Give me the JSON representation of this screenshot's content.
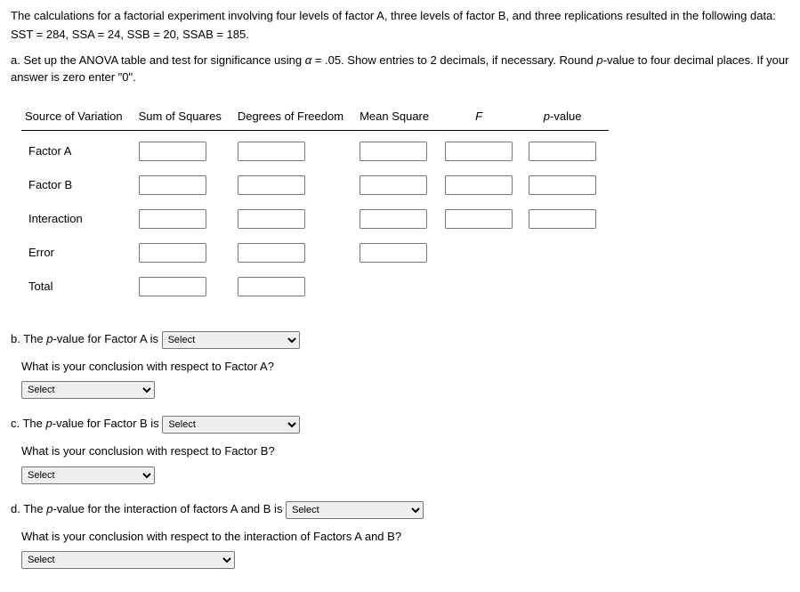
{
  "intro": "The calculations for a factorial experiment involving four levels of factor A, three levels of factor B, and three replications resulted in the following data: SST = 284, SSA = 24, SSB = 20, SSAB = 185.",
  "part_a": {
    "prefix": "a. Set up the ANOVA table and test for significance using ",
    "alpha": "α",
    "mid": " = .05. Show entries to 2 decimals, if necessary. Round ",
    "pval_word": "p",
    "suffix": "-value to four decimal places. If your answer is zero enter \"0\"."
  },
  "headers": {
    "source": "Source of Variation",
    "ss": "Sum of Squares",
    "df": "Degrees of Freedom",
    "ms": "Mean Square",
    "f": "F",
    "p": "p",
    "p_suffix": "-value"
  },
  "rows": {
    "a": "Factor A",
    "b": "Factor B",
    "int": "Interaction",
    "err": "Error",
    "tot": "Total"
  },
  "b": {
    "line_pre": "b. The ",
    "p": "p",
    "line_mid": "-value for Factor A is",
    "q": "What is your conclusion with respect to Factor A?"
  },
  "c": {
    "line_pre": "c. The ",
    "p": "p",
    "line_mid": "-value for Factor B is",
    "q": "What is your conclusion with respect to Factor B?"
  },
  "d": {
    "line_pre": "d. The ",
    "p": "p",
    "line_mid": "-value for the interaction of factors A and B is",
    "q": "What is your conclusion with respect to the interaction of Factors A and B?"
  },
  "select_default": "Select"
}
